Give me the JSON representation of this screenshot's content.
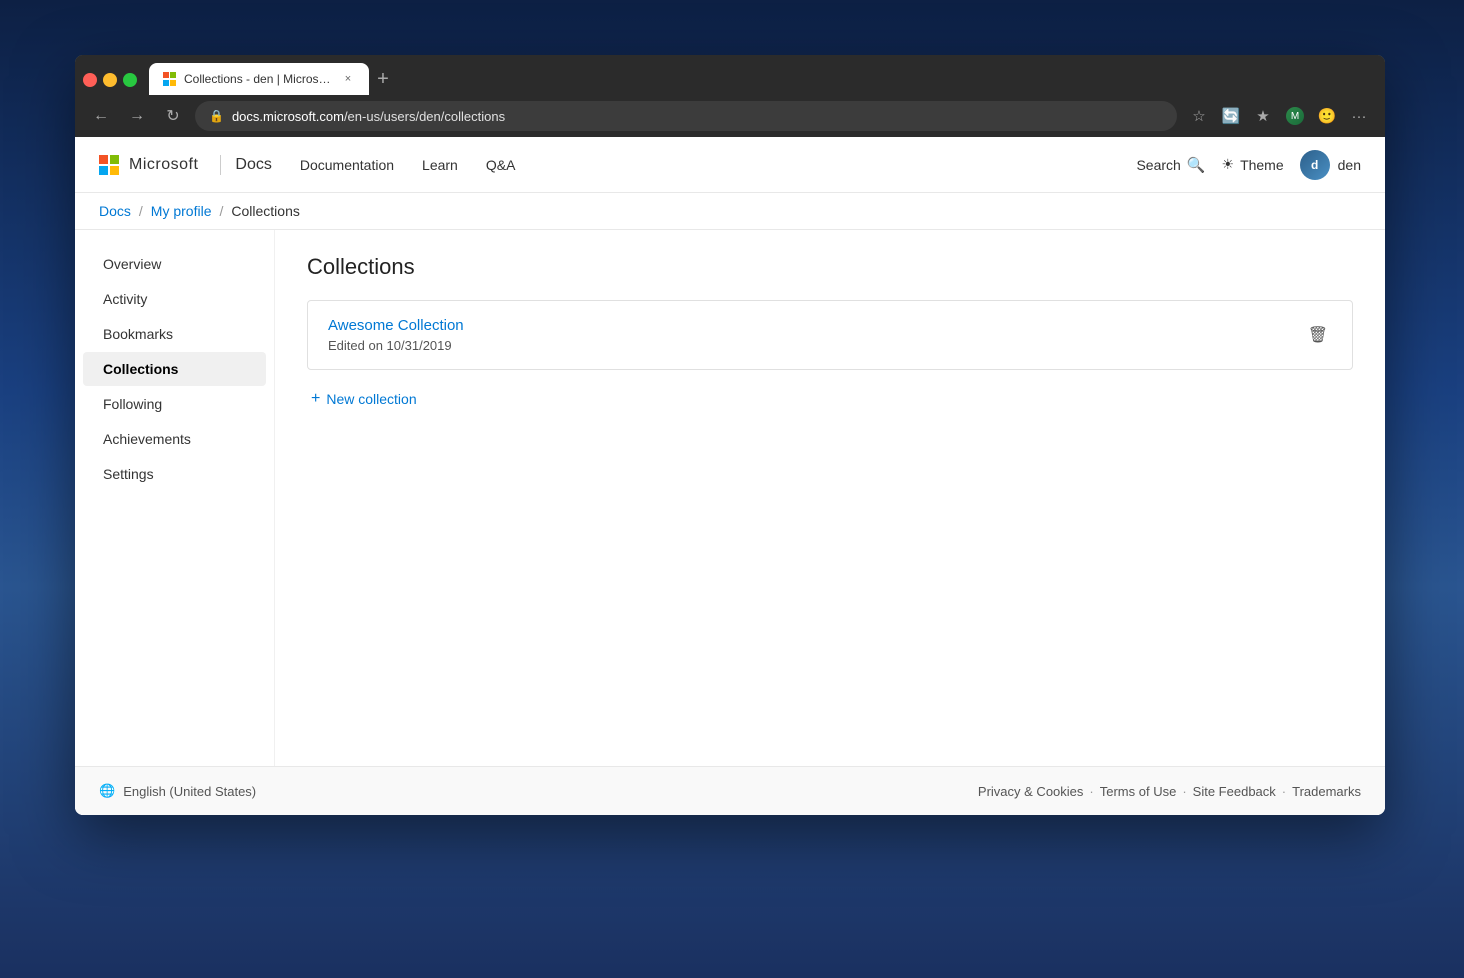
{
  "browser": {
    "tab_title": "Collections - den | Microsoft D...",
    "tab_close": "×",
    "tab_new": "+",
    "url": "https://docs.microsoft.com/en-us/users/den/collections",
    "url_domain": "docs.microsoft.com",
    "url_path": "/en-us/users/den/collections",
    "nav_back": "←",
    "nav_forward": "→",
    "nav_refresh": "↻"
  },
  "header": {
    "logo_text": "Microsoft",
    "site_name": "Docs",
    "nav_links": [
      {
        "label": "Documentation"
      },
      {
        "label": "Learn"
      },
      {
        "label": "Q&A"
      }
    ],
    "search_label": "Search",
    "theme_label": "Theme",
    "user_name": "den",
    "user_initials": "d"
  },
  "breadcrumb": {
    "docs_label": "Docs",
    "my_profile_label": "My profile",
    "current_label": "Collections",
    "sep": "/"
  },
  "sidebar": {
    "items": [
      {
        "label": "Overview",
        "id": "overview"
      },
      {
        "label": "Activity",
        "id": "activity"
      },
      {
        "label": "Bookmarks",
        "id": "bookmarks"
      },
      {
        "label": "Collections",
        "id": "collections",
        "active": true
      },
      {
        "label": "Following",
        "id": "following"
      },
      {
        "label": "Achievements",
        "id": "achievements"
      },
      {
        "label": "Settings",
        "id": "settings"
      }
    ]
  },
  "main": {
    "page_title": "Collections",
    "collection": {
      "name": "Awesome Collection",
      "edited": "Edited on 10/31/2019"
    },
    "new_collection_label": "New collection"
  },
  "footer": {
    "locale_icon": "🌐",
    "locale": "English (United States)",
    "links": [
      {
        "label": "Privacy & Cookies"
      },
      {
        "label": "Terms of Use"
      },
      {
        "label": "Site Feedback"
      },
      {
        "label": "Trademarks"
      }
    ]
  }
}
